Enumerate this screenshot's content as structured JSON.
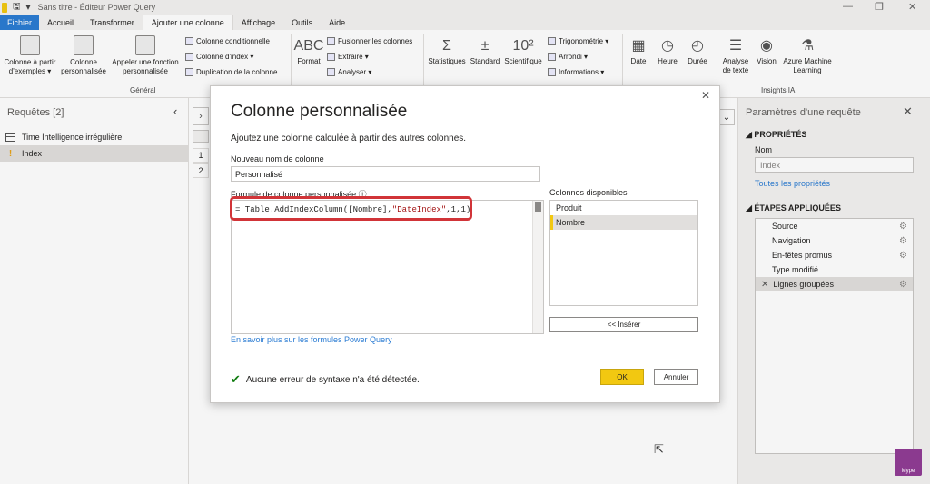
{
  "titlebar": {
    "title": "Sans titre - Éditeur Power Query"
  },
  "tabs": [
    "Fichier",
    "Accueil",
    "Transformer",
    "Ajouter une colonne",
    "Affichage",
    "Outils",
    "Aide"
  ],
  "ribbon": {
    "col_from_examples": [
      "Colonne à partir",
      "d'exemples ▾"
    ],
    "custom_column": [
      "Colonne",
      "personnalisée"
    ],
    "invoke_function": [
      "Appeler une fonction",
      "personnalisée"
    ],
    "conditional_column": "Colonne conditionnelle",
    "index_column": "Colonne d'index ▾",
    "duplicate_column": "Duplication de la colonne",
    "group_general": "Général",
    "format": "Format",
    "merge_columns": "Fusionner les colonnes",
    "extract": "Extraire ▾",
    "parse": "Analyser ▾",
    "statistics": "Statistiques",
    "standard": "Standard",
    "scientific": "Scientifique",
    "trigonometry": "Trigonométrie ▾",
    "rounding": "Arrondi ▾",
    "information": "Informations ▾",
    "date": "Date",
    "time": "Heure",
    "duration": "Durée",
    "text_analytics": [
      "Analyse",
      "de texte"
    ],
    "vision": "Vision",
    "azure_ml": [
      "Azure Machine",
      "Learning"
    ],
    "group_ai": "Insights IA"
  },
  "queries": {
    "header": "Requêtes [2]",
    "items": [
      {
        "label": "Time Intelligence irrégulière",
        "icon": "table-icon"
      },
      {
        "label": "Index",
        "icon": "warning-icon"
      }
    ]
  },
  "grid_rows": [
    "1",
    "2"
  ],
  "dialog": {
    "title": "Colonne personnalisée",
    "subtitle": "Ajoutez une colonne calculée à partir des autres colonnes.",
    "name_label": "Nouveau nom de colonne",
    "name_value": "Personnalisé",
    "formula_label": "Formule de colonne personnalisée",
    "formula_prefix": "= Table.AddIndexColumn(",
    "formula_arg1": "[Nombre]",
    "formula_sep1": ",",
    "formula_arg2": "\"DateIndex\"",
    "formula_suffix": ",1,1)",
    "columns_label": "Colonnes disponibles",
    "columns": [
      "Produit",
      "Nombre"
    ],
    "insert_button": "<< Insérer",
    "learn_more": "En savoir plus sur les formules Power Query",
    "status": "Aucune erreur de syntaxe n'a été détectée.",
    "ok": "OK",
    "cancel": "Annuler"
  },
  "settings": {
    "title": "Paramètres d'une requête",
    "properties_header": "PROPRIÉTÉS",
    "name_label": "Nom",
    "name_value": "Index",
    "all_properties": "Toutes les propriétés",
    "steps_header": "ÉTAPES APPLIQUÉES",
    "steps": [
      "Source",
      "Navigation",
      "En-têtes promus",
      "Type modifié",
      "Lignes groupées"
    ]
  },
  "logo_text": "Mype"
}
